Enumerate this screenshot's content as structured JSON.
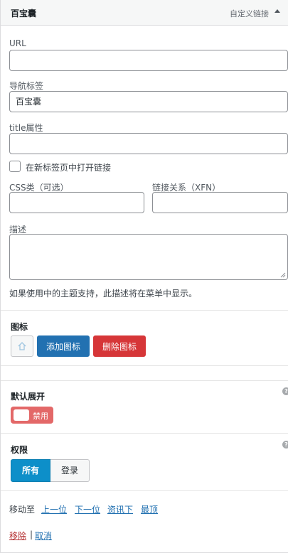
{
  "header": {
    "title": "百宝囊",
    "item_type": "自定义链接",
    "toggle_icon": "triangle-up-icon"
  },
  "fields": {
    "url": {
      "label": "URL",
      "value": ""
    },
    "nav_label": {
      "label": "导航标签",
      "value": "百宝囊"
    },
    "title_attr": {
      "label": "title属性",
      "value": ""
    },
    "new_tab": {
      "label": "在新标签页中打开链接",
      "checked": false
    },
    "css_classes": {
      "label": "CSS类（可选）",
      "value": ""
    },
    "xfn": {
      "label": "链接关系（XFN）",
      "value": ""
    },
    "description": {
      "label": "描述",
      "value": "",
      "hint": "如果使用中的主题支持，此描述将在菜单中显示。"
    }
  },
  "icon_section": {
    "title": "图标",
    "add_label": "添加图标",
    "remove_label": "删除图标",
    "preview_icon": "home-icon"
  },
  "expand_section": {
    "title": "默认展开",
    "toggle_label": "禁用",
    "enabled": false,
    "help_icon": "question-icon"
  },
  "permission_section": {
    "title": "权限",
    "options": [
      "所有",
      "登录"
    ],
    "selected": "所有",
    "help_icon": "question-icon"
  },
  "move": {
    "label": "移动至",
    "links": [
      "上一位",
      "下一位",
      "资讯下",
      "最顶"
    ]
  },
  "actions": {
    "remove": "移除",
    "separator": "|",
    "cancel": "取消"
  },
  "colors": {
    "primary": "#2271b1",
    "danger": "#d63638",
    "toggle_off": "#e36868",
    "segment_active": "#0d8fc9"
  }
}
